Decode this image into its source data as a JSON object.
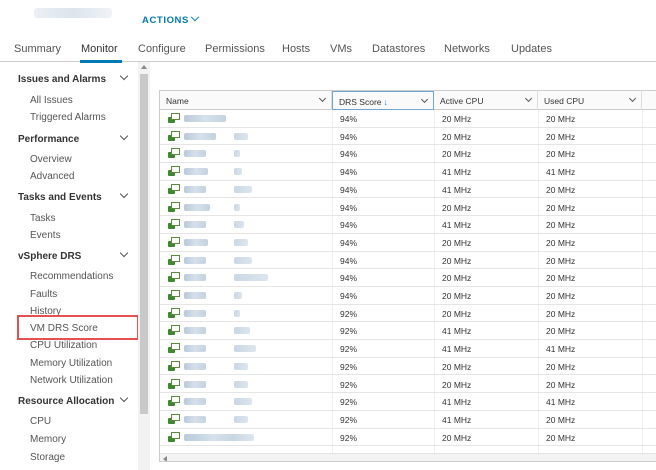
{
  "header": {
    "actions_label": "ACTIONS"
  },
  "tabs": [
    "Summary",
    "Monitor",
    "Configure",
    "Permissions",
    "Hosts",
    "VMs",
    "Datastores",
    "Networks",
    "Updates"
  ],
  "active_tab": "Monitor",
  "sidebar": {
    "sections": [
      {
        "label": "Issues and Alarms",
        "items": [
          "All Issues",
          "Triggered Alarms"
        ]
      },
      {
        "label": "Performance",
        "items": [
          "Overview",
          "Advanced"
        ]
      },
      {
        "label": "Tasks and Events",
        "items": [
          "Tasks",
          "Events"
        ]
      },
      {
        "label": "vSphere DRS",
        "items": [
          "Recommendations",
          "Faults",
          "History",
          "VM DRS Score",
          "CPU Utilization",
          "Memory Utilization",
          "Network Utilization"
        ]
      },
      {
        "label": "Resource Allocation",
        "items": [
          "CPU",
          "Memory",
          "Storage"
        ]
      }
    ],
    "highlighted_item": "VM DRS Score"
  },
  "table": {
    "columns": [
      "Name",
      "DRS Score",
      "Active CPU",
      "Used CPU"
    ],
    "sort_indicator": "↓",
    "rows": [
      {
        "drs": "94%",
        "active": "20 MHz",
        "used": "20 MHz"
      },
      {
        "drs": "94%",
        "active": "20 MHz",
        "used": "20 MHz"
      },
      {
        "drs": "94%",
        "active": "20 MHz",
        "used": "20 MHz"
      },
      {
        "drs": "94%",
        "active": "41 MHz",
        "used": "41 MHz"
      },
      {
        "drs": "94%",
        "active": "41 MHz",
        "used": "20 MHz"
      },
      {
        "drs": "94%",
        "active": "20 MHz",
        "used": "20 MHz"
      },
      {
        "drs": "94%",
        "active": "41 MHz",
        "used": "20 MHz"
      },
      {
        "drs": "94%",
        "active": "20 MHz",
        "used": "20 MHz"
      },
      {
        "drs": "94%",
        "active": "20 MHz",
        "used": "20 MHz"
      },
      {
        "drs": "94%",
        "active": "20 MHz",
        "used": "20 MHz"
      },
      {
        "drs": "94%",
        "active": "20 MHz",
        "used": "20 MHz"
      },
      {
        "drs": "92%",
        "active": "20 MHz",
        "used": "20 MHz"
      },
      {
        "drs": "92%",
        "active": "41 MHz",
        "used": "20 MHz"
      },
      {
        "drs": "92%",
        "active": "41 MHz",
        "used": "41 MHz"
      },
      {
        "drs": "92%",
        "active": "20 MHz",
        "used": "20 MHz"
      },
      {
        "drs": "92%",
        "active": "20 MHz",
        "used": "20 MHz"
      },
      {
        "drs": "92%",
        "active": "41 MHz",
        "used": "41 MHz"
      },
      {
        "drs": "92%",
        "active": "41 MHz",
        "used": "20 MHz"
      },
      {
        "drs": "92%",
        "active": "20 MHz",
        "used": "20 MHz"
      }
    ]
  },
  "colors": {
    "accent": "#0079b8",
    "highlight_border": "#e55050",
    "vm_icon": "#3c8a2e"
  }
}
